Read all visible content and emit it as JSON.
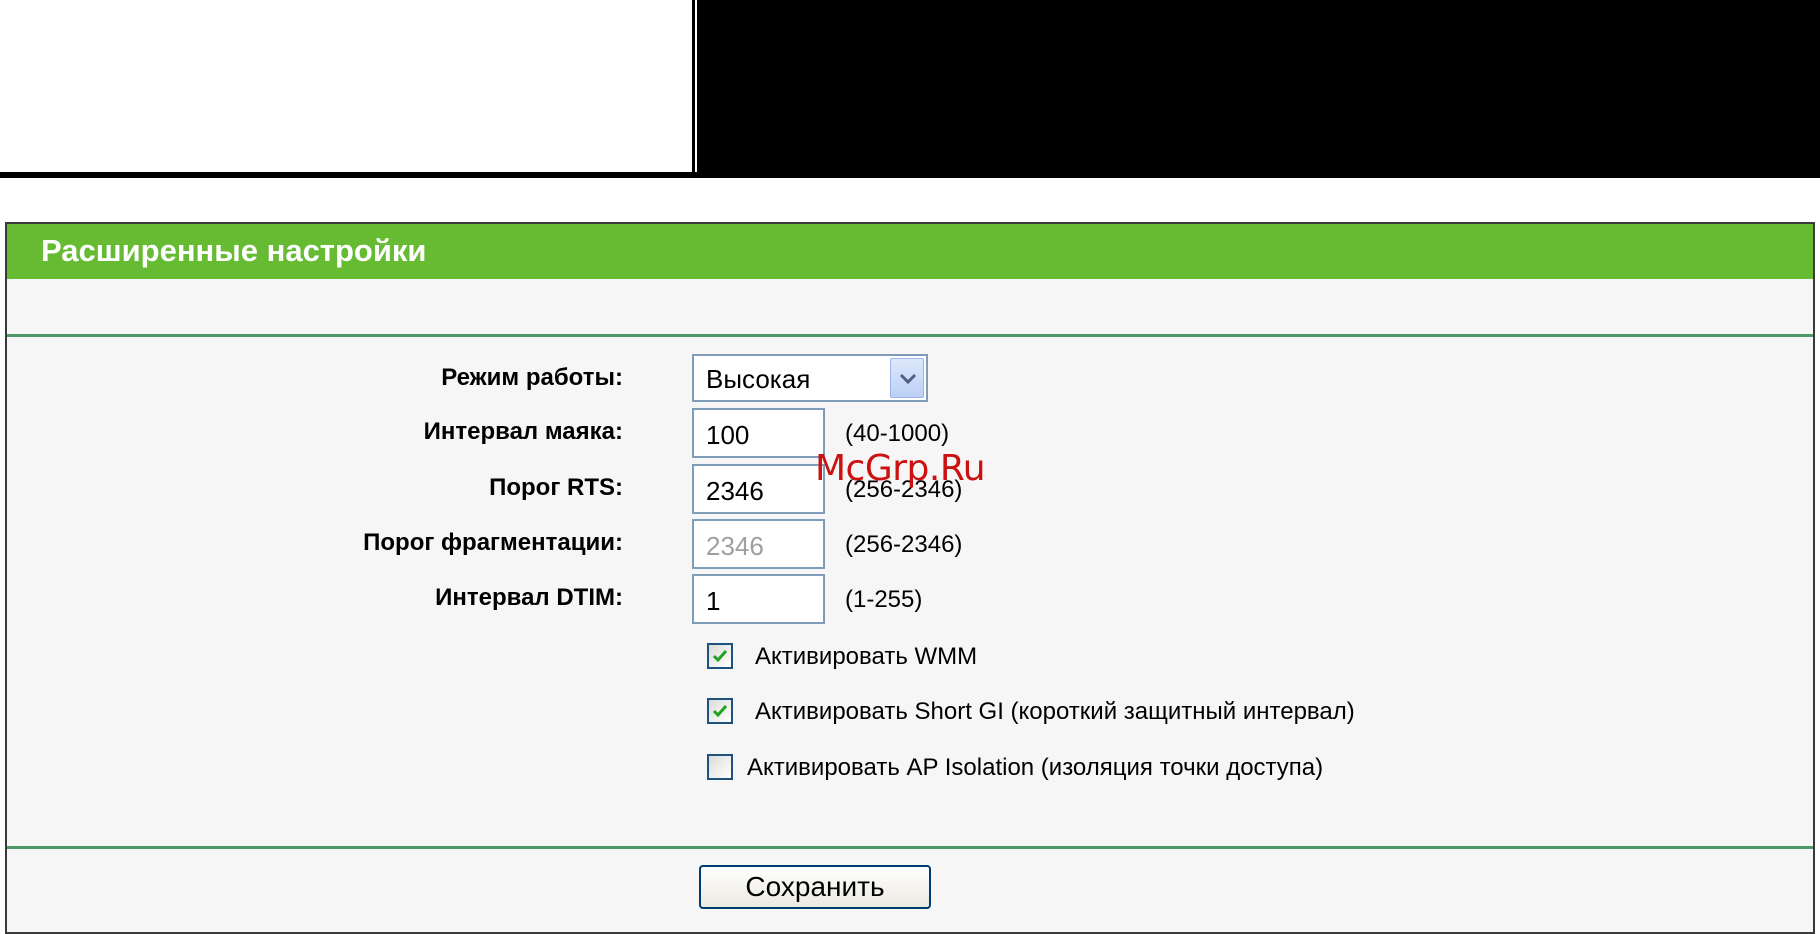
{
  "panel": {
    "title": "Расширенные настройки"
  },
  "form": {
    "mode": {
      "label": "Режим работы:",
      "selected": "Высокая"
    },
    "beacon_interval": {
      "label": "Интервал маяка:",
      "value": "100",
      "range": "(40-1000)"
    },
    "rts_threshold": {
      "label": "Порог RTS:",
      "value": "2346",
      "range": "(256-2346)"
    },
    "fragmentation_threshold": {
      "label": "Порог фрагментации:",
      "value": "2346",
      "range": "(256-2346)"
    },
    "dtim_interval": {
      "label": "Интервал DTIM:",
      "value": "1",
      "range": "(1-255)"
    },
    "checkboxes": [
      {
        "label": "Активировать WMM",
        "checked": true
      },
      {
        "label": "Активировать Short GI (короткий защитный интервал)",
        "checked": true
      },
      {
        "label": "Активировать AP Isolation (изоляция точки доступа)",
        "checked": false
      }
    ],
    "save_label": "Сохранить"
  },
  "watermark": "McGrp.Ru",
  "colors": {
    "header_green": "#66bb33",
    "rule_green": "#4a9a6a",
    "panel_bg": "#f6f6f6",
    "watermark_red": "#cc1111"
  }
}
